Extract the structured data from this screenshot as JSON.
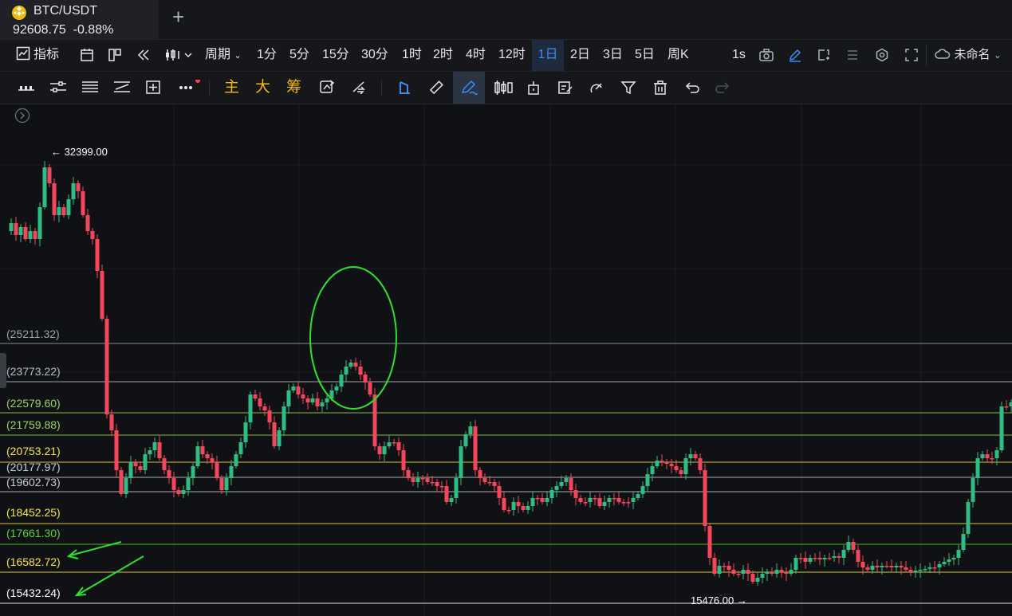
{
  "symbol": {
    "name": "BTC/USDT",
    "price": "92608.75",
    "change": "-0.88%"
  },
  "toolbar1": {
    "indicators": "指标",
    "period": "周期",
    "intervals": [
      "1分",
      "5分",
      "15分",
      "30分",
      "1时",
      "2时",
      "4时",
      "12时",
      "1日",
      "2日",
      "3日",
      "5日",
      "周K"
    ],
    "active_interval": "1日",
    "seconds": "1s",
    "layout_name": "未命名"
  },
  "toolbar2": {
    "main": "主",
    "big": "大",
    "chip": "筹"
  },
  "chart": {
    "high_marker": "32399.00",
    "low_marker": "15476.00",
    "levels": [
      {
        "label": "(25211.32)",
        "color": "#9aa0aa"
      },
      {
        "label": "(23773.22)",
        "color": "#b8bcc4"
      },
      {
        "label": "(22579.60)",
        "color": "#9bd35a"
      },
      {
        "label": "(21759.88)",
        "color": "#9bd35a"
      },
      {
        "label": "(20753.21)",
        "color": "#f5e63c"
      },
      {
        "label": "(20177.97)",
        "color": "#c9ccd2"
      },
      {
        "label": "(19602.73)",
        "color": "#c9ccd2"
      },
      {
        "label": "(18452.25)",
        "color": "#f5e63c"
      },
      {
        "label": "(17661.30)",
        "color": "#5ecf3a"
      },
      {
        "label": "(16582.72)",
        "color": "#f5e63c"
      },
      {
        "label": "(15432.24)",
        "color": "#ffffff"
      }
    ],
    "up_color": "#2ebd85",
    "down_color": "#f6465d",
    "annotation_color": "#2ee02e"
  }
}
